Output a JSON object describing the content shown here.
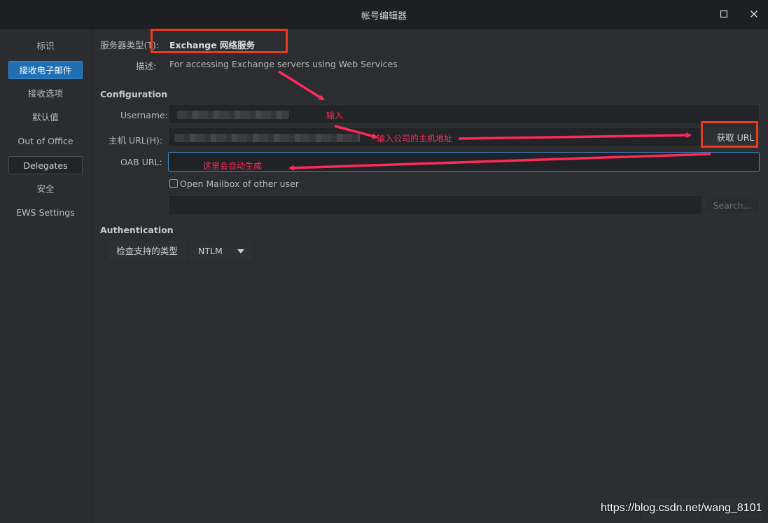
{
  "window": {
    "title": "帐号编辑器"
  },
  "sidebar": {
    "items": [
      {
        "label": "标识"
      },
      {
        "label": "接收电子邮件"
      },
      {
        "label": "接收选项"
      },
      {
        "label": "默认值"
      },
      {
        "label": "Out of Office"
      },
      {
        "label": "Delegates"
      },
      {
        "label": "安全"
      },
      {
        "label": "EWS Settings"
      }
    ]
  },
  "server": {
    "type_label": "服务器类型(T):",
    "type_value": "Exchange 网络服务",
    "desc_label": "描述:",
    "desc_value": "For accessing Exchange servers using Web Services"
  },
  "configuration": {
    "heading": "Configuration",
    "username_label": "Username:",
    "host_label": "主机 URL(H):",
    "fetch_url_button": "获取 URL",
    "oab_label": "OAB URL:",
    "open_mailbox_label": "Open Mailbox of other user",
    "search_button": "Search..."
  },
  "authentication": {
    "heading": "Authentication",
    "check_button": "检查支持的类型",
    "method": "NTLM"
  },
  "annotations": {
    "input": "输入",
    "host_hint": "输入公司的主机地址",
    "auto_hint": "这里会自动生成"
  },
  "watermark": "https://blog.csdn.net/wang_8101",
  "colors": {
    "accent": "#1f6fb4",
    "annotation": "#ff2a5a",
    "highlight_box": "#ee3b1d"
  }
}
